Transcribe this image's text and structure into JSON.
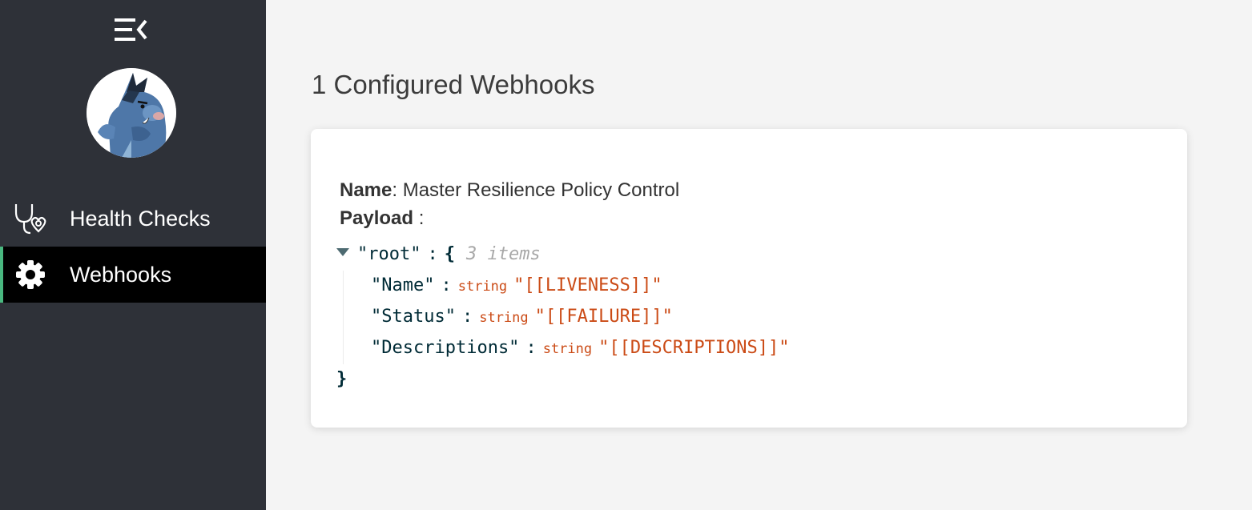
{
  "sidebar": {
    "toggle_icon": "menu-collapse-icon",
    "avatar_icon": "boar-mascot-avatar",
    "items": [
      {
        "label": "Health Checks",
        "icon": "stethoscope-icon",
        "active": false
      },
      {
        "label": "Webhooks",
        "icon": "gear-icon",
        "active": true
      }
    ],
    "colors": {
      "background": "#2e3138",
      "active_background": "#000000",
      "active_accent": "#49b880"
    }
  },
  "main": {
    "title": "1 Configured Webhooks",
    "webhook": {
      "name_label": "Name",
      "name_value": "Master Resilience Policy Control",
      "payload_label": "Payload",
      "payload": {
        "root_key": "\"root\"",
        "open_brace": "{",
        "close_brace": "}",
        "items_count": "3 items",
        "entries": [
          {
            "key": "\"Name\"",
            "type": "string",
            "value": "\"[[LIVENESS]]\""
          },
          {
            "key": "\"Status\"",
            "type": "string",
            "value": "\"[[FAILURE]]\""
          },
          {
            "key": "\"Descriptions\"",
            "type": "string",
            "value": "\"[[DESCRIPTIONS]]\""
          }
        ]
      }
    }
  }
}
